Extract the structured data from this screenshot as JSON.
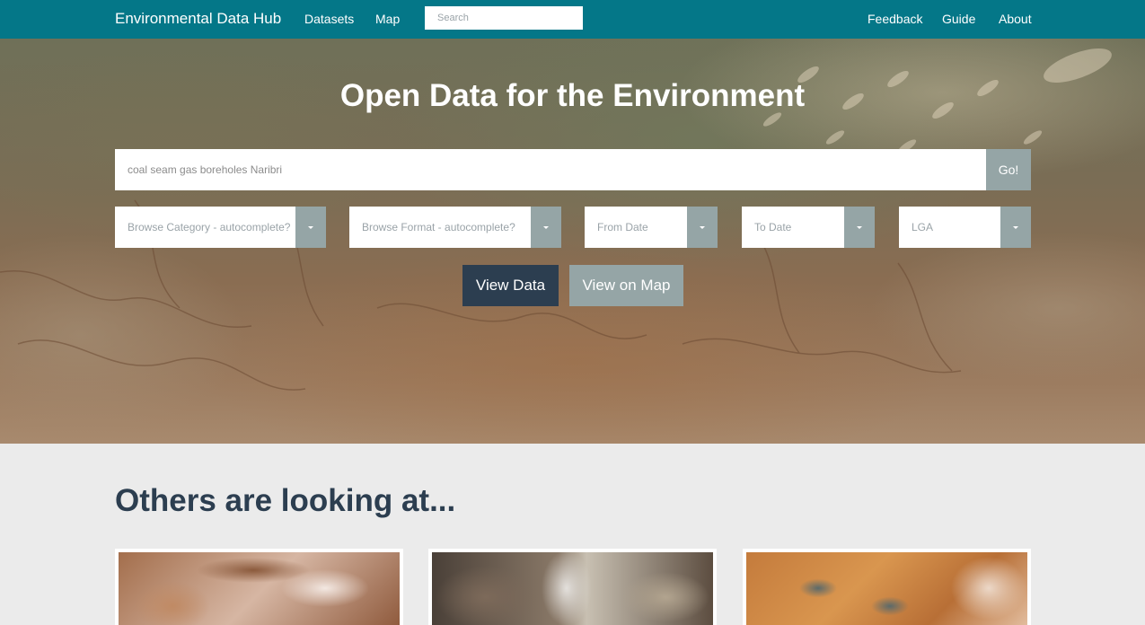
{
  "nav": {
    "brand": "Environmental Data Hub",
    "links": [
      "Datasets",
      "Map"
    ],
    "search_placeholder": "Search",
    "right_links": [
      "Feedback",
      "Guide",
      "About"
    ],
    "color": "#047788"
  },
  "hero": {
    "title": "Open Data for the Environment",
    "search_placeholder": "coal seam gas boreholes Naribri",
    "go_label": "Go!",
    "filters": [
      "Browse Category - autocomplete?",
      "Browse Format - autocomplete?",
      "From Date",
      "To Date",
      "LGA"
    ],
    "view_data_label": "View Data",
    "view_map_label": "View on Map"
  },
  "popular": {
    "title": "Others are looking at...",
    "cards": 3
  },
  "colors": {
    "dark": "#2c3e50",
    "muted": "#95a5a6"
  }
}
